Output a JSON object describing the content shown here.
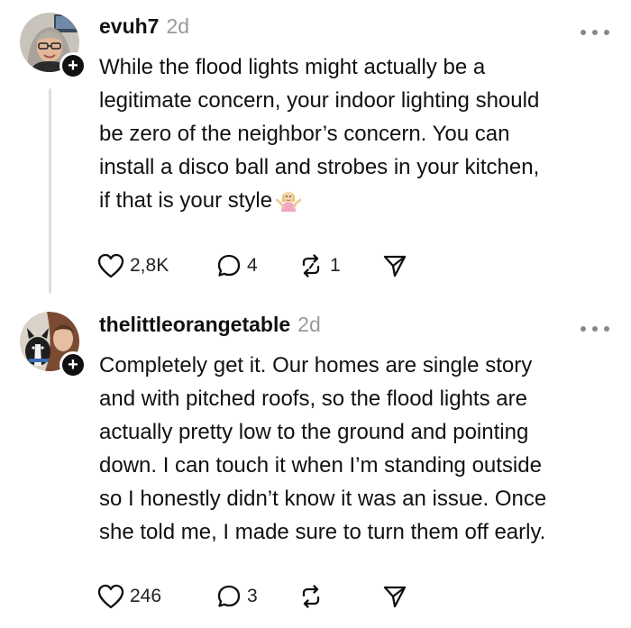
{
  "posts": [
    {
      "username": "evuh7",
      "time": "2d",
      "text_lines": [
        "While the flood lights might actually be a",
        "legitimate concern, your indoor lighting should",
        "be zero of the neighbor’s concern. You can",
        "install a disco ball and strobes in your kitchen,",
        "if that is your style"
      ],
      "emoji": "woman-shrugging-emoji",
      "likes": "2,8K",
      "replies": "4",
      "reposts": "1"
    },
    {
      "username": "thelittleorangetable",
      "time": "2d",
      "text_lines": [
        "Completely get it. Our homes are single story",
        "and with pitched roofs, so the flood lights are",
        "actually pretty low to the ground and pointing",
        "down. I can touch it when I’m standing outside",
        "so I honestly didn’t know it was an issue. Once",
        "she told me, I made sure to turn them off early."
      ],
      "likes": "246",
      "replies": "3",
      "reposts": ""
    }
  ],
  "icons": {
    "like": "heart-icon",
    "reply": "speech-bubble-icon",
    "repost": "repost-arrows-icon",
    "share": "paper-plane-icon",
    "more": "more-dots-icon",
    "follow": "plus-icon"
  },
  "colors": {
    "text": "#111111",
    "muted": "#999999",
    "thread_line": "#dddddd",
    "badge": "#111111"
  }
}
